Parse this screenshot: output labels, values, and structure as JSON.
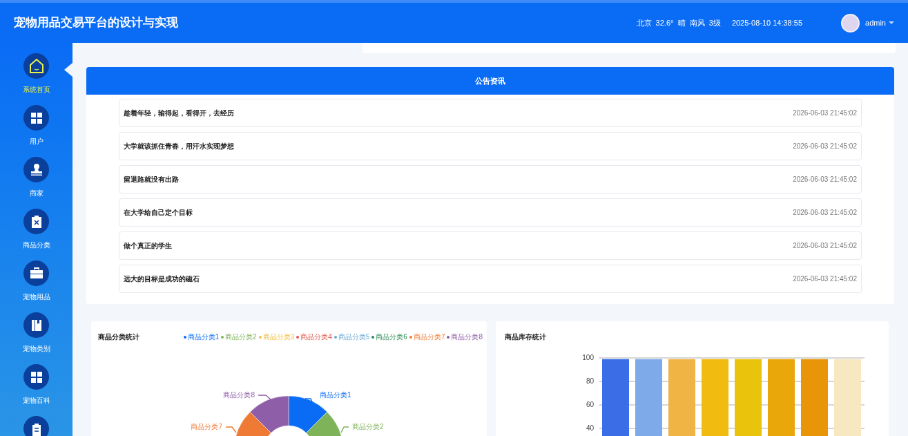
{
  "header": {
    "title": "宠物用品交易平台的设计与实现",
    "weather": "北京  32.6°  晴  南风  3级",
    "datetime": "2025-08-10 14:38:55",
    "user": "admin"
  },
  "sidebar": {
    "items": [
      {
        "kind": "house",
        "label": "系统首页",
        "selected": true
      },
      {
        "kind": "grid",
        "label": "用户",
        "selected": false
      },
      {
        "kind": "stamp",
        "label": "商家",
        "selected": false
      },
      {
        "kind": "clipboard-x",
        "label": "商品分类",
        "selected": false
      },
      {
        "kind": "briefcase",
        "label": "宠物用品",
        "selected": false
      },
      {
        "kind": "book",
        "label": "宠物类别",
        "selected": false
      },
      {
        "kind": "grid",
        "label": "宠物百科",
        "selected": false
      },
      {
        "kind": "clipboard"
      }
    ]
  },
  "announcements": {
    "title": "公告资讯",
    "items": [
      {
        "text": "趁着年轻，输得起，看得开，去经历",
        "time": "2026-06-03 21:45:02"
      },
      {
        "text": "大学就该抓住青春，用汗水实现梦想",
        "time": "2026-06-03 21:45:02"
      },
      {
        "text": "留退路就没有出路",
        "time": "2026-06-03 21:45:02"
      },
      {
        "text": "在大学给自己定个目标",
        "time": "2026-06-03 21:45:02"
      },
      {
        "text": "做个真正的学生",
        "time": "2026-06-03 21:45:02"
      },
      {
        "text": "远大的目标是成功的磁石",
        "time": "2026-06-03 21:45:02"
      }
    ]
  },
  "category_chart": {
    "title": "商品分类统计",
    "legend": [
      {
        "label": "商品分类1",
        "color": "#0a6cf5"
      },
      {
        "label": "商品分类2",
        "color": "#7eb35a"
      },
      {
        "label": "商品分类3",
        "color": "#f2c043"
      },
      {
        "label": "商品分类4",
        "color": "#e05a4e"
      },
      {
        "label": "商品分类5",
        "color": "#6aaad8"
      },
      {
        "label": "商品分类6",
        "color": "#2e8b57"
      },
      {
        "label": "商品分类7",
        "color": "#ee7a35"
      },
      {
        "label": "商品分类8",
        "color": "#8e5ea8"
      }
    ],
    "slice_labels": [
      {
        "label": "商品分类1",
        "color": "#0a6cf5"
      },
      {
        "label": "商品分类2",
        "color": "#7eb35a"
      },
      {
        "label": "商品分类7",
        "color": "#ee7a35"
      },
      {
        "label": "商品分类8",
        "color": "#8e5ea8"
      }
    ]
  },
  "stock_chart": {
    "title": "商品库存统计",
    "chart_data": {
      "type": "bar",
      "yticks": [
        40,
        60,
        80,
        100
      ],
      "ylim": [
        0,
        100
      ],
      "grid": true,
      "values": [
        99,
        99,
        99,
        99,
        99,
        99,
        99,
        99
      ],
      "colors": [
        "#3a6de6",
        "#7eaaea",
        "#f0b445",
        "#f2bb0f",
        "#eac40c",
        "#e9a70a",
        "#e8950a",
        "#f7e8c2"
      ]
    }
  }
}
